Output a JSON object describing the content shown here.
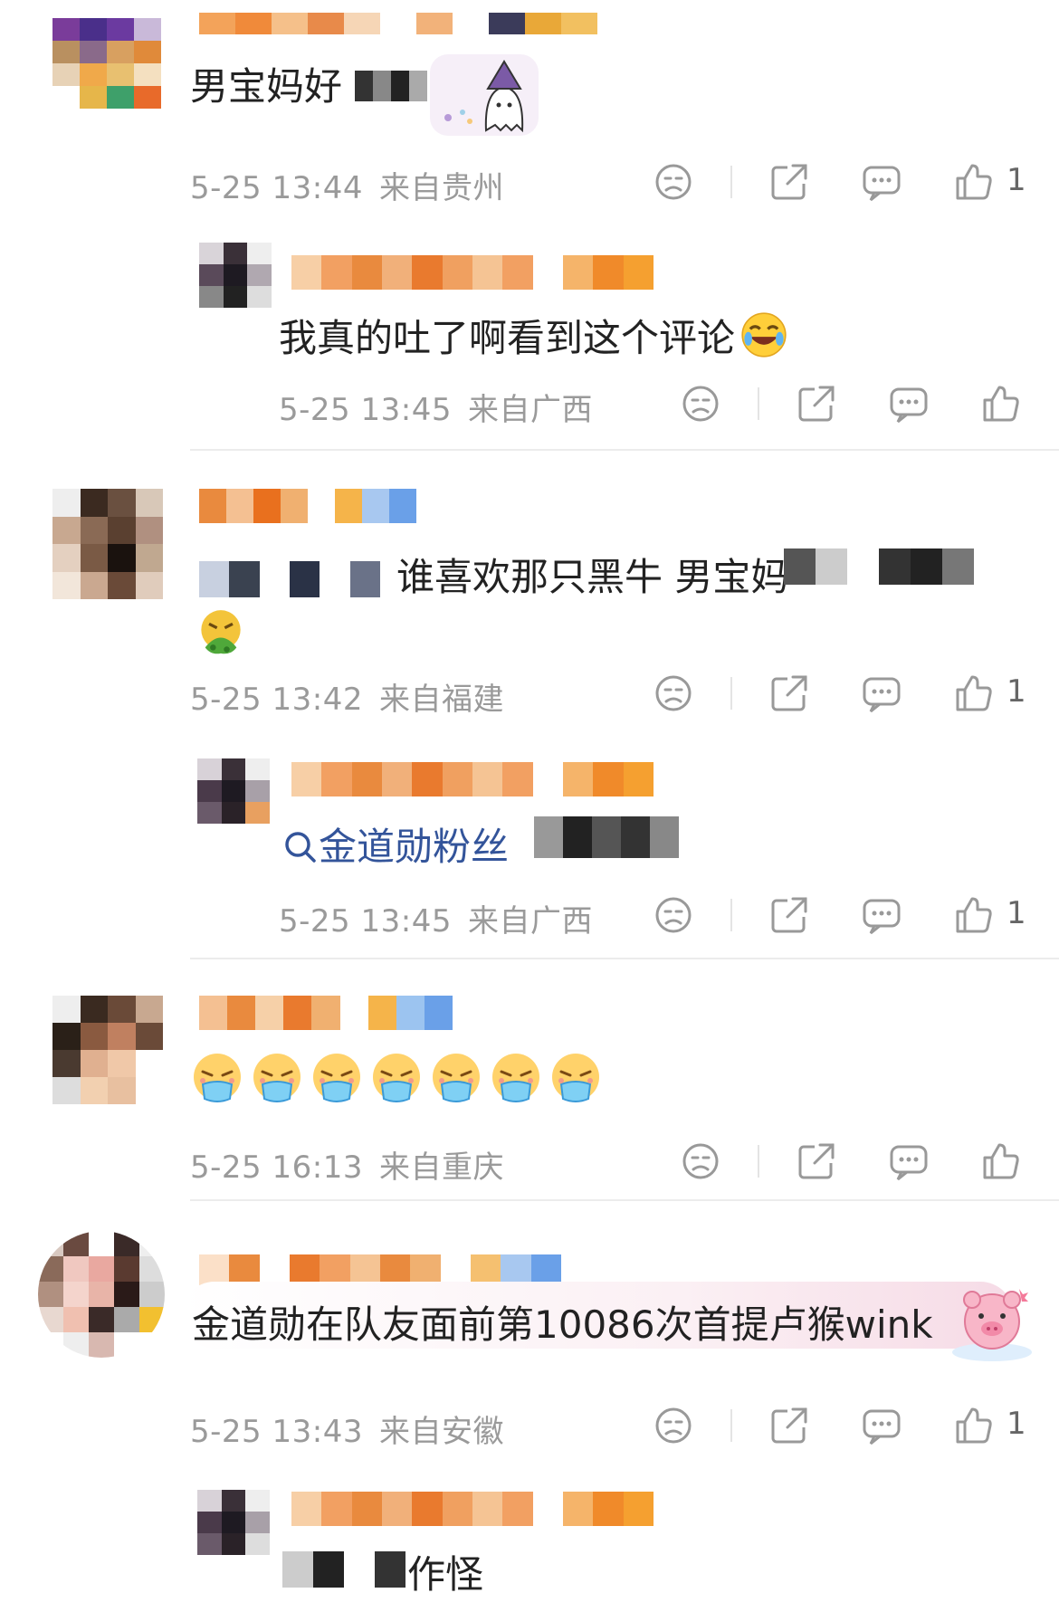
{
  "comments": [
    {
      "content": "男宝妈好",
      "time": "5-25 13:44",
      "location": "来自贵州",
      "likes": "1"
    },
    {
      "content": "我真的吐了啊看到这个评论",
      "time": "5-25 13:45",
      "location": "来自广西",
      "likes": ""
    },
    {
      "content": "谁喜欢那只黑牛 男宝妈",
      "time": "5-25 13:42",
      "location": "来自福建",
      "likes": "1"
    },
    {
      "content_link": "金道勋粉丝",
      "time": "5-25 13:45",
      "location": "来自广西",
      "likes": "1"
    },
    {
      "content": "",
      "time": "5-25 16:13",
      "location": "来自重庆",
      "likes": ""
    },
    {
      "content": "金道勋在队友面前第10086次首提卢猴wink",
      "time": "5-25 13:43",
      "location": "来自安徽",
      "likes": "1"
    },
    {
      "content": "作怪"
    }
  ],
  "icons": [
    "dislike-icon",
    "share-icon",
    "reply-icon",
    "like-icon",
    "search-icon"
  ],
  "colors": {
    "text": "#222222",
    "meta": "#9a9a9a",
    "link": "#33549a",
    "divider": "#ececec"
  }
}
